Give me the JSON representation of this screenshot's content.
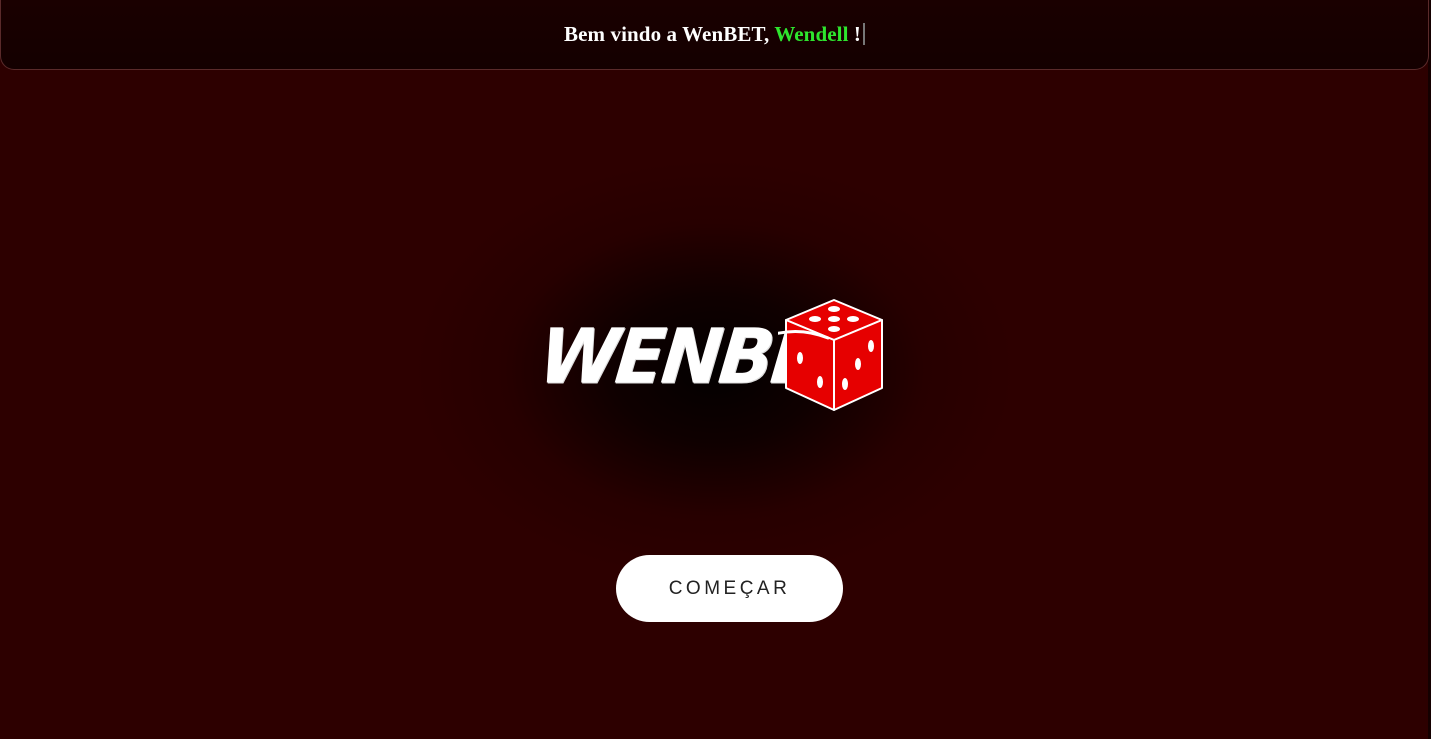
{
  "header": {
    "greeting_prefix": "Bem vindo a WenBET, ",
    "username": "Wendell",
    "greeting_suffix": " !"
  },
  "logo": {
    "wordmark": "WENBET"
  },
  "actions": {
    "start_label": "COMEÇAR"
  },
  "colors": {
    "background": "#2d0000",
    "username_accent": "#2ee62e",
    "dice_red": "#e60000",
    "button_bg": "#ffffff"
  },
  "icons": {
    "logo_dice": "dice-icon"
  }
}
